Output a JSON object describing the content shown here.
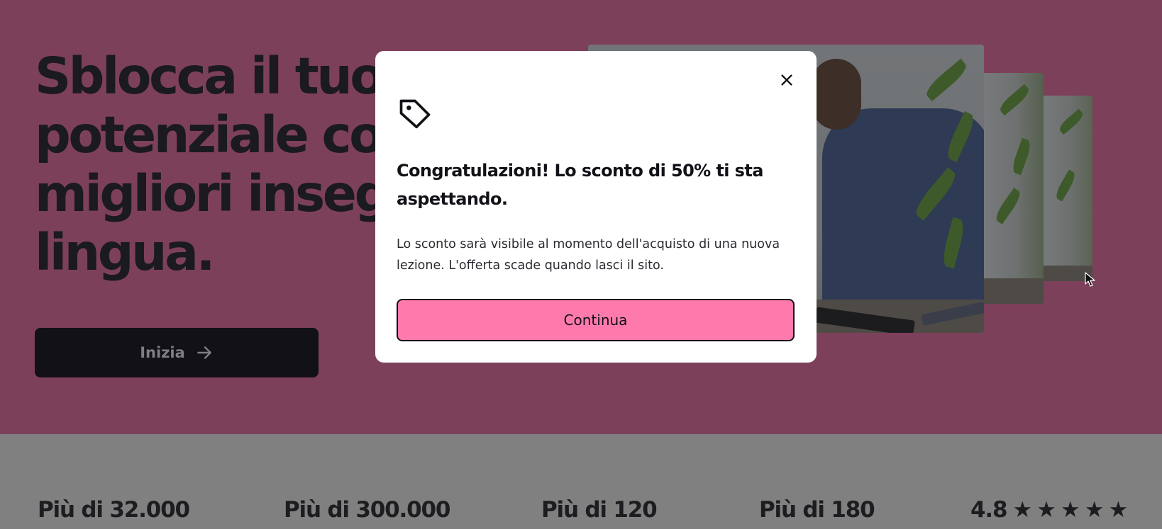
{
  "hero": {
    "title_lines": [
      "Sblocca il tuo",
      "potenziale con i",
      "migliori insegnanti di",
      "lingua."
    ],
    "cta_label": "Inizia",
    "cta_icon": "arrow-right-icon"
  },
  "stats": {
    "tutors": "Più di 32.000",
    "reviews": "Più di 300.000",
    "subjects": "Più di 120",
    "nationalities": "Più di 180",
    "rating": "4.8",
    "rating_stars": "★★★★★"
  },
  "modal": {
    "icon": "tag-icon",
    "title": "Congratulazioni! Lo sconto di 50% ti sta aspettando.",
    "body": "Lo sconto sarà visibile al momento dell'acquisto di una nuova lezione. L'offerta scade quando lasci il sito.",
    "continue_label": "Continua",
    "close_icon": "close-icon"
  },
  "colors": {
    "hero_bg": "#7d405a",
    "overlay_gray": "#808080",
    "primary_button": "#ff7aac",
    "dark": "#121117"
  }
}
